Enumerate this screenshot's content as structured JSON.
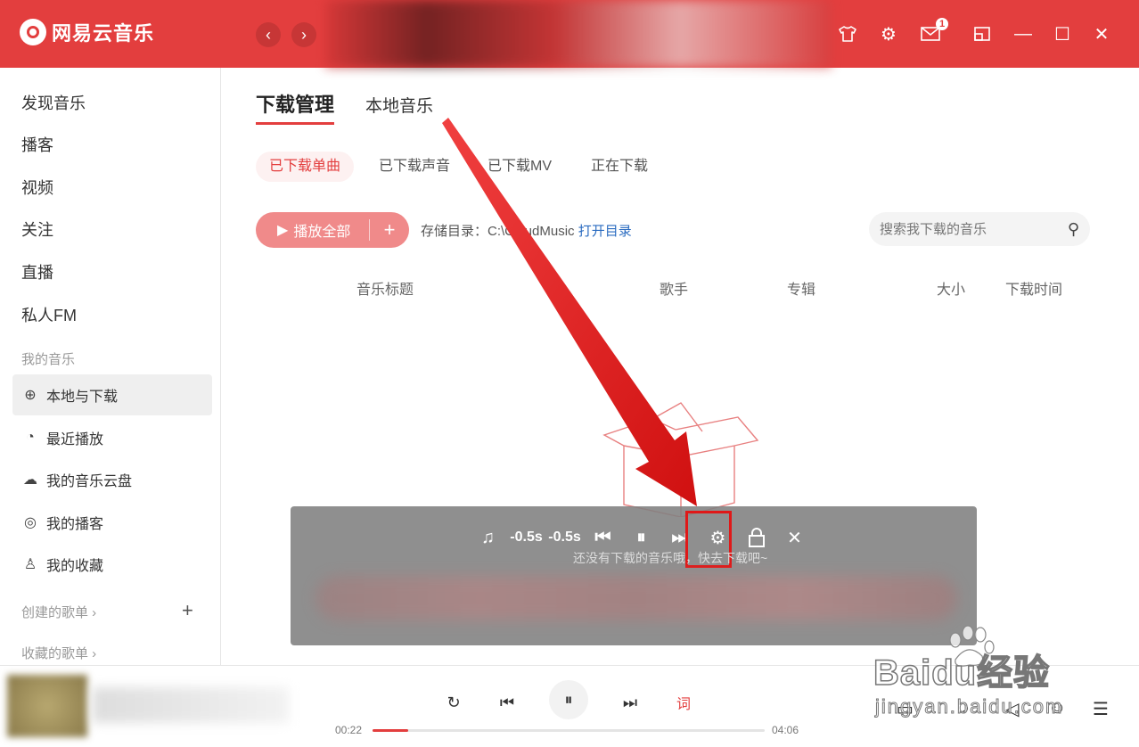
{
  "app": {
    "name": "网易云音乐",
    "brand_color": "#e33e3e",
    "message_badge": "1"
  },
  "sidebar": {
    "items": [
      "发现音乐",
      "播客",
      "视频",
      "关注",
      "直播",
      "私人FM"
    ],
    "my_music_section": "我的音乐",
    "my_music": [
      {
        "label": "本地与下载",
        "icon": "download-icon",
        "active": true
      },
      {
        "label": "最近播放",
        "icon": "history-icon"
      },
      {
        "label": "我的音乐云盘",
        "icon": "cloud-icon"
      },
      {
        "label": "我的播客",
        "icon": "podcast-icon"
      },
      {
        "label": "我的收藏",
        "icon": "person-icon"
      }
    ],
    "created_playlists": "创建的歌单",
    "collected_playlists": "收藏的歌单"
  },
  "main": {
    "tabs": [
      "下载管理",
      "本地音乐"
    ],
    "subtabs": [
      "已下载单曲",
      "已下载声音",
      "已下载MV",
      "正在下载"
    ],
    "play_all": "播放全部",
    "storage_label": "存储目录：C:\\CloudMusic",
    "open_dir": "打开目录",
    "search_placeholder": "搜索我下载的音乐",
    "columns": [
      "音乐标题",
      "歌手",
      "专辑",
      "大小",
      "下载时间"
    ],
    "empty_text": "还没有下载的音乐哦，快去下载吧~"
  },
  "lyric_toolbar": {
    "offset_minus": "-0.5s",
    "offset_plus": "-0.5s"
  },
  "player": {
    "current_time": "00:22",
    "total_time": "04:06",
    "progress": 0.09,
    "lyric_btn": "词"
  },
  "watermark": {
    "text": "Baidu经验",
    "sub": "jingyan.baidu.com"
  }
}
